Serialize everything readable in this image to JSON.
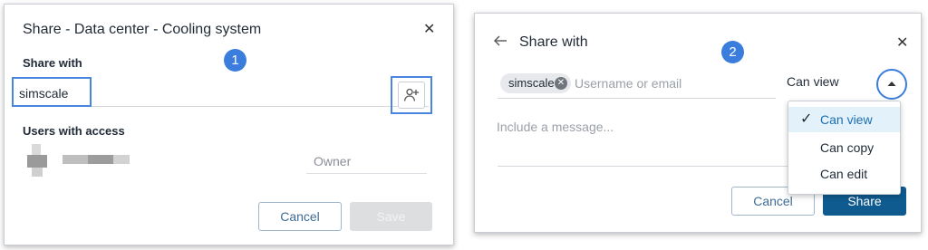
{
  "dialog1": {
    "title": "Share - Data center - Cooling system",
    "close_icon": "close-icon",
    "badge": "1",
    "share_with_label": "Share with",
    "search_value": "simscale",
    "add_user_icon": "add-user-icon",
    "users_label": "Users with access",
    "owner_role": "Owner",
    "cancel_label": "Cancel",
    "save_label": "Save"
  },
  "dialog2": {
    "back_icon": "arrow-left-icon",
    "title": "Share with",
    "close_icon": "close-icon",
    "badge": "2",
    "chip_label": "simscale",
    "chip_remove_icon": "close-circle-icon",
    "user_placeholder": "Username or email",
    "permission_value": "Can view",
    "toggle_icon": "caret-up-icon",
    "message_placeholder": "Include a message...",
    "menu": [
      {
        "label": "Can view",
        "selected": true
      },
      {
        "label": "Can copy",
        "selected": false
      },
      {
        "label": "Can edit",
        "selected": false
      }
    ],
    "cancel_label": "Cancel",
    "share_label": "Share"
  },
  "colors": {
    "accent": "#3b7ddd",
    "primary_button": "#0f5a8f",
    "selected_row": "#e3f1fb",
    "disabled_button": "#dcdee0"
  }
}
